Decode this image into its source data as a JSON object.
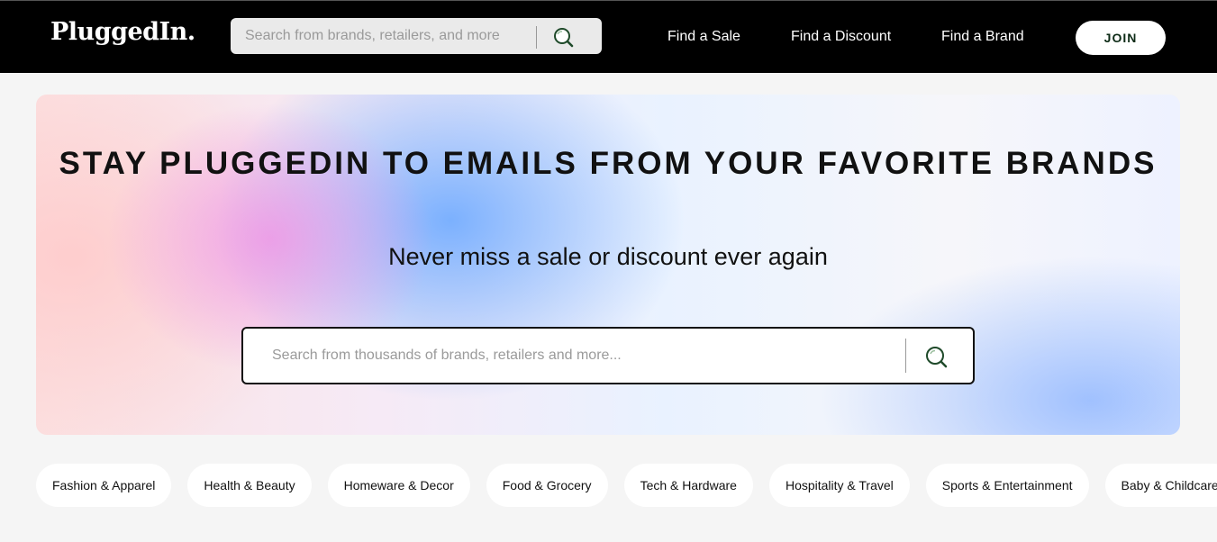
{
  "header": {
    "logo": "PluggedIn.",
    "search_placeholder": "Search from brands, retailers, and more",
    "nav": [
      "Find a Sale",
      "Find a Discount",
      "Find a Brand"
    ],
    "join_label": "JOIN"
  },
  "hero": {
    "title": "STAY PLUGGEDIN TO EMAILS FROM YOUR FAVORITE BRANDS",
    "subtitle": "Never miss a sale or discount ever again",
    "search_placeholder": "Search from thousands of brands, retailers and more..."
  },
  "categories": [
    "Fashion & Apparel",
    "Health & Beauty",
    "Homeware & Decor",
    "Food & Grocery",
    "Tech & Hardware",
    "Hospitality & Travel",
    "Sports & Entertainment",
    "Baby & Childcare"
  ],
  "icons": {
    "search": "search-icon"
  },
  "colors": {
    "header_bg": "#000000",
    "search_icon_green": "#1f4a2a",
    "join_text": "#0d2b16"
  }
}
